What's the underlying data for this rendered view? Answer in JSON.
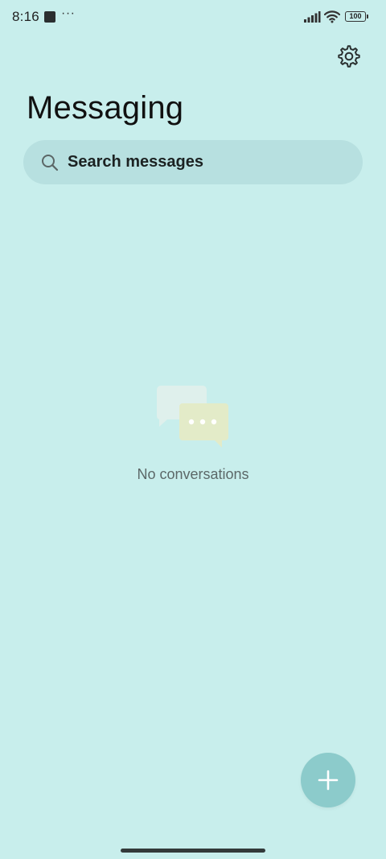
{
  "status_bar": {
    "time": "8:16",
    "more_indicator": "···",
    "battery_level": "100",
    "icons": [
      "notification-square-icon",
      "signal-icon",
      "wifi-icon",
      "battery-icon"
    ]
  },
  "header": {
    "title": "Messaging",
    "settings_icon": "gear-icon"
  },
  "search": {
    "placeholder": "Search messages",
    "icon": "search-icon"
  },
  "empty_state": {
    "illustration": "chat-bubbles-icon",
    "message": "No conversations"
  },
  "fab": {
    "icon": "plus-icon",
    "color": "#8ccbcb"
  },
  "colors": {
    "background": "#c8eeec",
    "search_background": "#b7e0e0",
    "accent": "#8ccbcb"
  }
}
